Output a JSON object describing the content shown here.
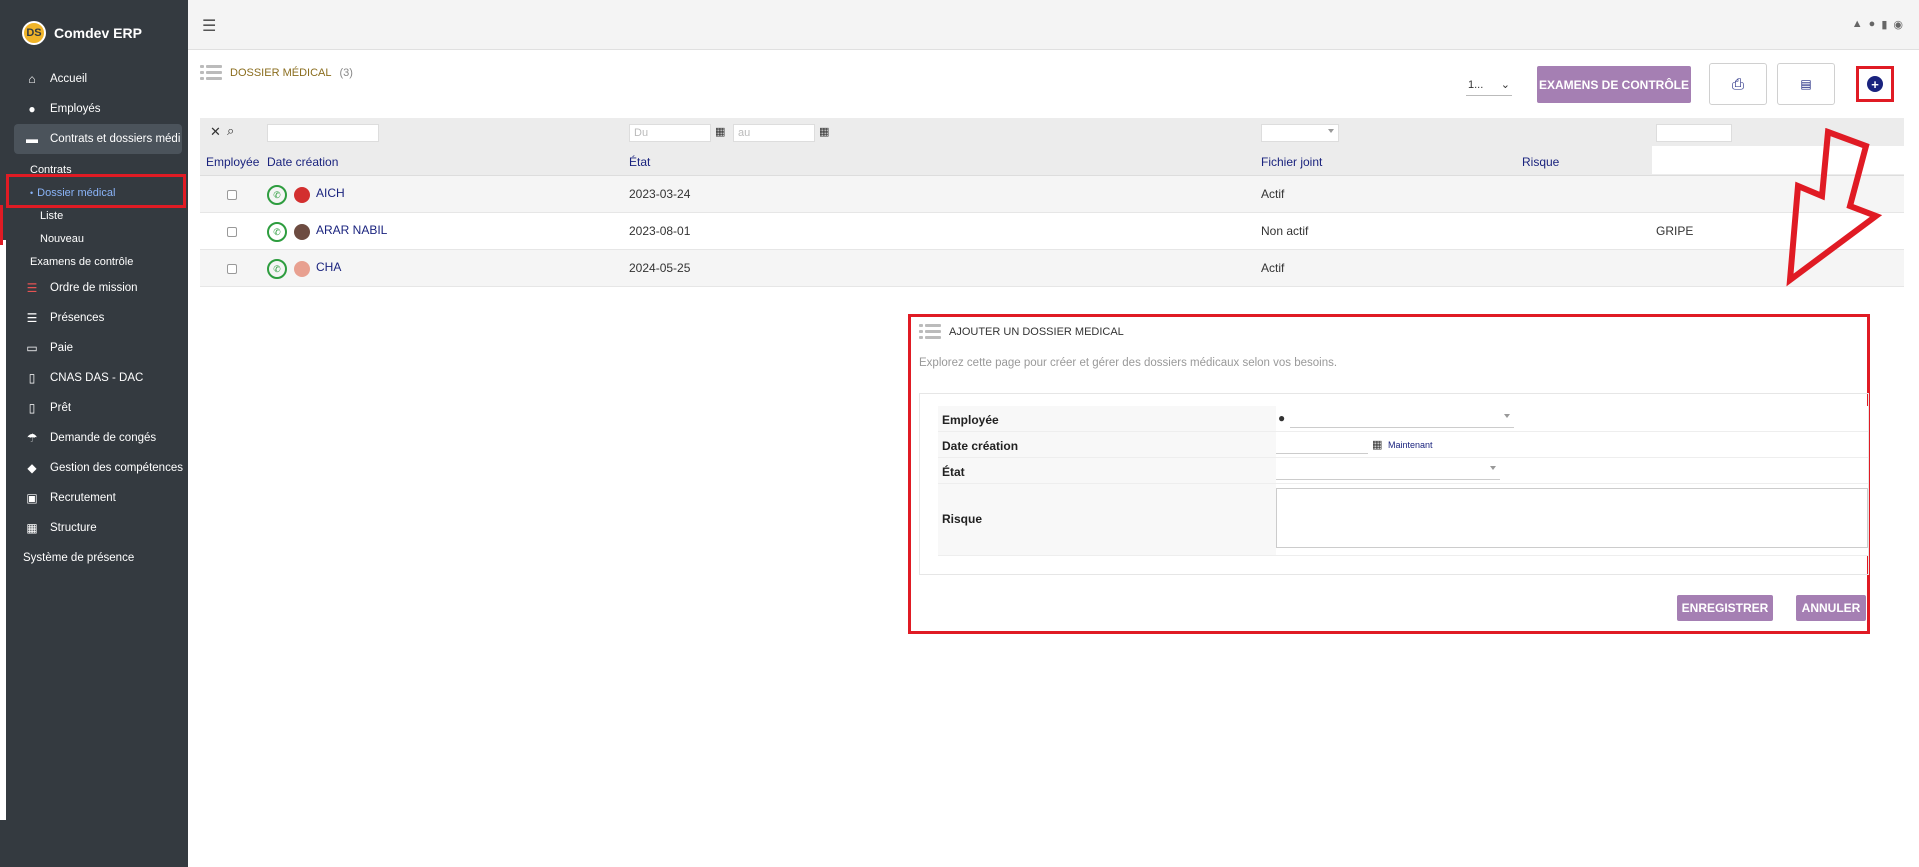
{
  "app": {
    "name": "Comdev ERP",
    "logo_text": "DS"
  },
  "sidebar": {
    "items": [
      {
        "label": "Accueil",
        "icon": "home-icon"
      },
      {
        "label": "Employés",
        "icon": "user-icon"
      },
      {
        "label": "Contrats et dossiers médi",
        "icon": "folder-icon"
      },
      {
        "label": "Ordre de mission",
        "icon": "list-icon"
      },
      {
        "label": "Présences",
        "icon": "list-icon"
      },
      {
        "label": "Paie",
        "icon": "money-icon"
      },
      {
        "label": "CNAS DAS - DAC",
        "icon": "document-icon"
      },
      {
        "label": "Prêt",
        "icon": "document-icon"
      },
      {
        "label": "Demande de congés",
        "icon": "umbrella-icon"
      },
      {
        "label": "Gestion des compétences",
        "icon": "cubes-icon"
      },
      {
        "label": "Recrutement",
        "icon": "briefcase-icon"
      },
      {
        "label": "Structure",
        "icon": "building-icon"
      },
      {
        "label": "Système de présence",
        "icon": ""
      }
    ],
    "sub": {
      "contrats": "Contrats",
      "dossier_medical": "Dossier médical",
      "liste": "Liste",
      "nouveau": "Nouveau",
      "examens": "Examens de contrôle"
    }
  },
  "page": {
    "title": "DOSSIER MÉDICAL",
    "count": "(3)",
    "pager_value": "1...",
    "btn_exam": "EXAMENS DE CONTRÔLE",
    "accent": "#a57fb3"
  },
  "filters": {
    "date_from_placeholder": "Du",
    "date_to_placeholder": "au"
  },
  "table": {
    "columns": [
      "Employée",
      "Date création",
      "État",
      "Fichier joint",
      "Risque"
    ],
    "rows": [
      {
        "name": "AICH",
        "date": "2023-03-24",
        "etat": "Actif",
        "risque": ""
      },
      {
        "name": "ARAR NABIL",
        "date": "2023-08-01",
        "etat": "Non actif",
        "risque": "GRIPE"
      },
      {
        "name": "CHA",
        "date": "2024-05-25",
        "etat": "Actif",
        "risque": ""
      }
    ]
  },
  "form": {
    "title": "AJOUTER UN DOSSIER MEDICAL",
    "description": "Explorez cette page pour créer et gérer des dossiers médicaux selon vos besoins.",
    "labels": {
      "employee": "Employée",
      "date": "Date création",
      "etat": "État",
      "risque": "Risque"
    },
    "now_link": "Maintenant",
    "save": "ENREGISTRER",
    "cancel": "ANNULER"
  }
}
